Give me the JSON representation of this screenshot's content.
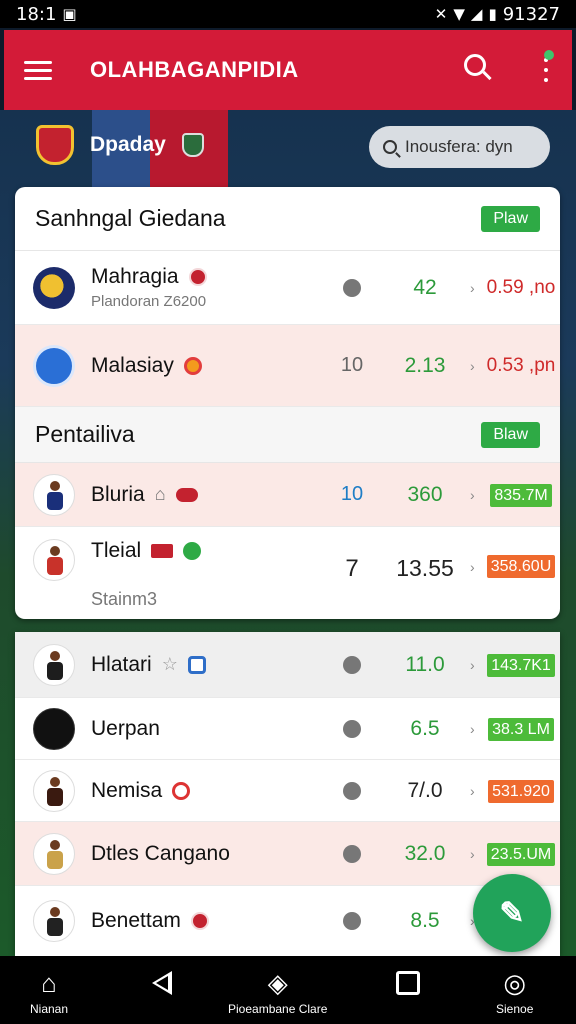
{
  "status_bar": {
    "time": "18:1",
    "right_text": "91327"
  },
  "app_bar": {
    "title": "OLAHBAGANPIDIA"
  },
  "club": {
    "name": "Dpaday"
  },
  "search": {
    "placeholder": "Inousfera: dyn"
  },
  "section1": {
    "title": "Sanhngal Giedana",
    "badge": "Plaw",
    "rows": [
      {
        "name": "Mahragia",
        "sub": "Plandoran Z6200",
        "col_a": "",
        "col_b": "42",
        "col_c": "0.59 ,no"
      },
      {
        "name": "Malasiay",
        "sub": "",
        "col_a": "10",
        "col_b": "2.13",
        "col_c": "0.53 ,pn"
      }
    ]
  },
  "section2": {
    "title": "Pentailiva",
    "badge": "Blaw",
    "rows": [
      {
        "name": "Bluria",
        "col_a": "10",
        "col_b": "360",
        "col_c": "835.7M"
      },
      {
        "name": "Tleial",
        "sub": "Stainm3",
        "col_a": "7",
        "col_b": "13.55",
        "col_c": "358.60U"
      }
    ]
  },
  "list": {
    "rows": [
      {
        "name": "Hlatari",
        "col_b": "11.0",
        "col_c": "143.7K1"
      },
      {
        "name": "Uerpan",
        "col_b": "6.5",
        "col_c": "38.3 LM"
      },
      {
        "name": "Nemisa",
        "col_b": "7/.0",
        "col_c": "531.920"
      },
      {
        "name": "Dtles Cangano",
        "col_b": "32.0",
        "col_c": "23.5.UM"
      },
      {
        "name": "Benettam",
        "col_b": "8.5",
        "col_c": ""
      }
    ]
  },
  "bottom_nav": {
    "home_label": "Nianan",
    "center_label": "Pioeambane Clare",
    "profile_label": "Sienoe"
  },
  "colors": {
    "app_bar": "#d31b38",
    "accent_green": "#2eaa45",
    "tag_orange": "#ef6a2e"
  }
}
